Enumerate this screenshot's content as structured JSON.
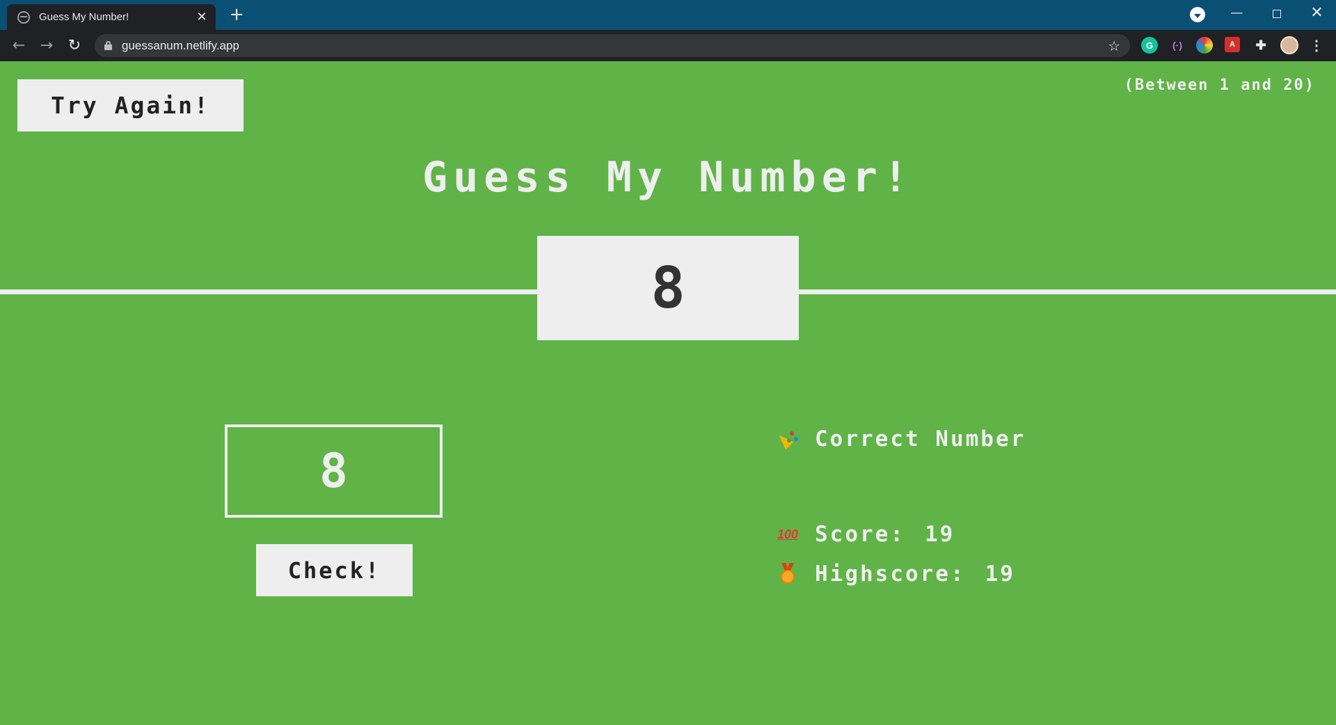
{
  "browser": {
    "tab_title": "Guess My Number!",
    "tab_close": "✕",
    "new_tab": "+",
    "url": "guessanum.netlify.app",
    "back": "←",
    "forward": "→",
    "reload": "↻",
    "bookmark": "☆",
    "window_minimize": "—",
    "window_close": "✕",
    "extensions": {
      "grammarly": "G",
      "podcast": "(·)",
      "pdf": "A",
      "puzzle": "✚",
      "menu": "⋮"
    },
    "colors": {
      "tab_strip": "#0a4f74",
      "toolbar": "#202124"
    }
  },
  "game": {
    "again_label": "Try Again!",
    "between_label": "(Between 1 and 20)",
    "title": "Guess My Number!",
    "secret_number": "8",
    "guess_value": "8",
    "check_label": "Check!",
    "message": "Correct Number",
    "score_label": "Score:",
    "score_value": "19",
    "highscore_label": "Highscore:",
    "highscore_value": "19",
    "icons": {
      "message": "party-popper-icon",
      "score": "hundred-points-icon",
      "highscore": "medal-icon"
    },
    "colors": {
      "background": "#60b347",
      "foreground": "#eeeeee",
      "dark_text": "#333333"
    }
  }
}
